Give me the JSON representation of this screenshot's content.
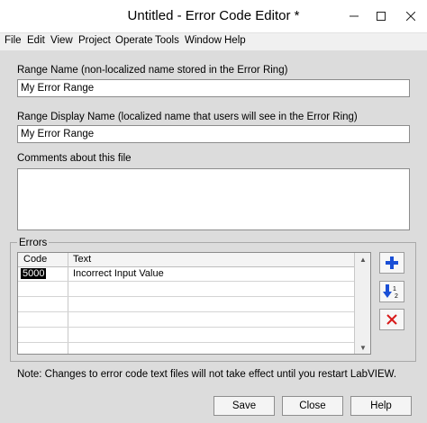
{
  "window": {
    "title": "Untitled - Error Code Editor *"
  },
  "menu": [
    "File",
    "Edit",
    "View",
    "Project",
    "Operate",
    "Tools",
    "Window",
    "Help"
  ],
  "range_name": {
    "label": "Range Name (non-localized name stored in the Error Ring)",
    "value": "My Error Range"
  },
  "range_display_name": {
    "label": "Range Display Name (localized name that users will see in the Error Ring)",
    "value": "My Error Range"
  },
  "comments": {
    "label": "Comments about this file",
    "value": ""
  },
  "errors": {
    "group_label": "Errors",
    "columns": [
      "Code",
      "Text"
    ],
    "rows": [
      {
        "code": "5000",
        "text": "Incorrect Input Value"
      }
    ]
  },
  "side_buttons": {
    "add_icon": "plus-icon",
    "sort_icon": "sort-icon",
    "delete_icon": "x-icon",
    "sort_label": "1\n2"
  },
  "note": "Note: Changes to error code text files will not take effect until you restart LabVIEW.",
  "buttons": {
    "save": "Save",
    "close": "Close",
    "help": "Help"
  },
  "colors": {
    "add": "#1a4fd6",
    "delete": "#d81a1a",
    "selection": "#000000"
  }
}
